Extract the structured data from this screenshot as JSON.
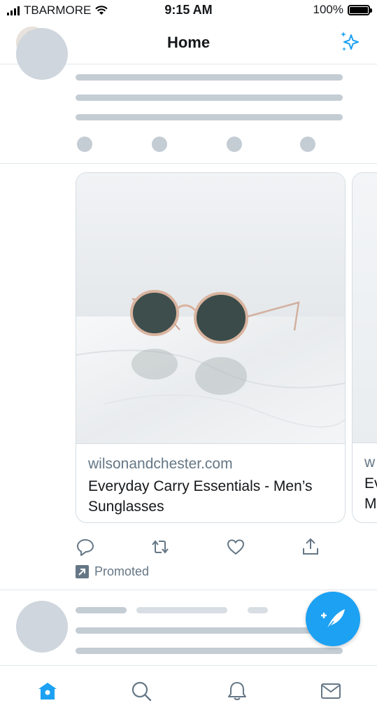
{
  "status_bar": {
    "carrier": "TBARMORE",
    "time": "9:15 AM",
    "battery": "100%"
  },
  "header": {
    "title": "Home",
    "avatar": "profile-avatar",
    "action_icon": "sparkle-icon"
  },
  "promoted_tweet": {
    "cards": [
      {
        "domain": "wilsonandchester.com",
        "title": "Everyday Carry Essentials - Men’s Sunglasses",
        "image": "round-sunglasses-photo"
      },
      {
        "domain": "w",
        "title_line1": "Ev",
        "title_line2": "M"
      }
    ],
    "actions": [
      "reply-icon",
      "retweet-icon",
      "like-icon",
      "share-icon"
    ],
    "promoted_label": "Promoted"
  },
  "compose_button": {
    "icon": "compose-feather-icon"
  },
  "tab_bar": {
    "tabs": [
      "home-icon",
      "search-icon",
      "notifications-icon",
      "messages-icon"
    ],
    "active": "home-icon"
  },
  "colors": {
    "accent": "#1da1f2",
    "skeleton": "#c4ccd4",
    "muted_text": "#657786"
  }
}
